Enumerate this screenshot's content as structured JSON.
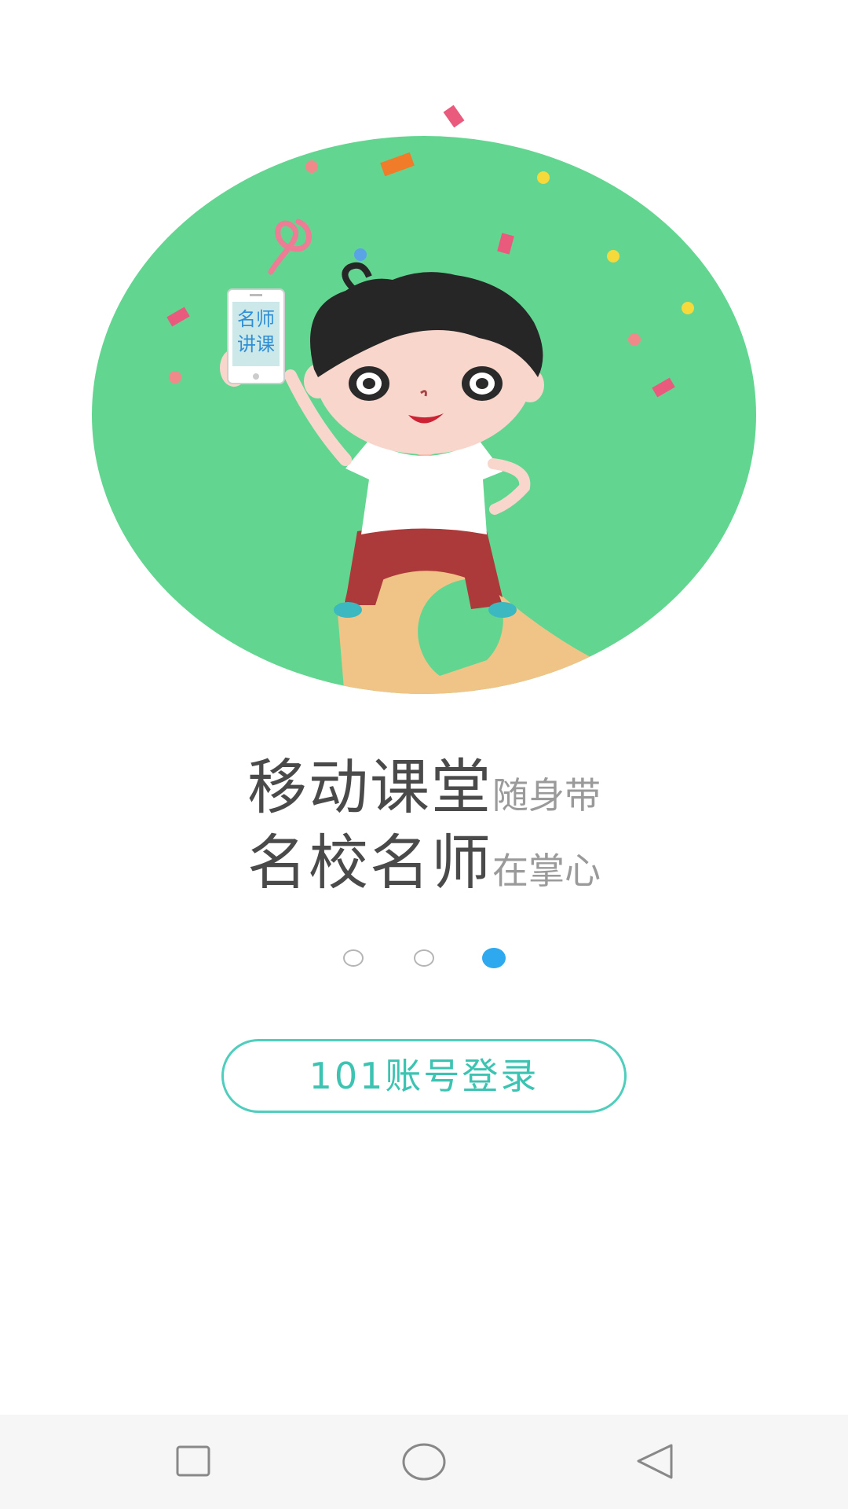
{
  "illustration": {
    "phone_text_line1": "名师",
    "phone_text_line2": "讲课",
    "colors": {
      "circle": "#62d690",
      "hair": "#262626",
      "skin": "#f9d6cc",
      "shirt": "#ffffff",
      "shorts": "#ad3a3a",
      "shoes": "#3bb8c0",
      "path": "#f0c487",
      "confetti_pink": "#e95a7d",
      "confetti_orange": "#f07b28",
      "confetti_yellow": "#f6d93a",
      "confetti_blue": "#5aa3e6",
      "phone_text": "#2f8fd6"
    }
  },
  "slogan": {
    "line1_main": "移动课堂",
    "line1_sub": "随身带",
    "line2_main": "名校名师",
    "line2_sub": "在掌心"
  },
  "pager": {
    "count": 3,
    "active_index": 2,
    "active_color": "#2ea8ef"
  },
  "login_button": {
    "label": "101账号登录",
    "color": "#3cc3b2"
  },
  "navbar": {
    "icons": [
      "recent-apps-icon",
      "home-icon",
      "back-icon"
    ]
  }
}
